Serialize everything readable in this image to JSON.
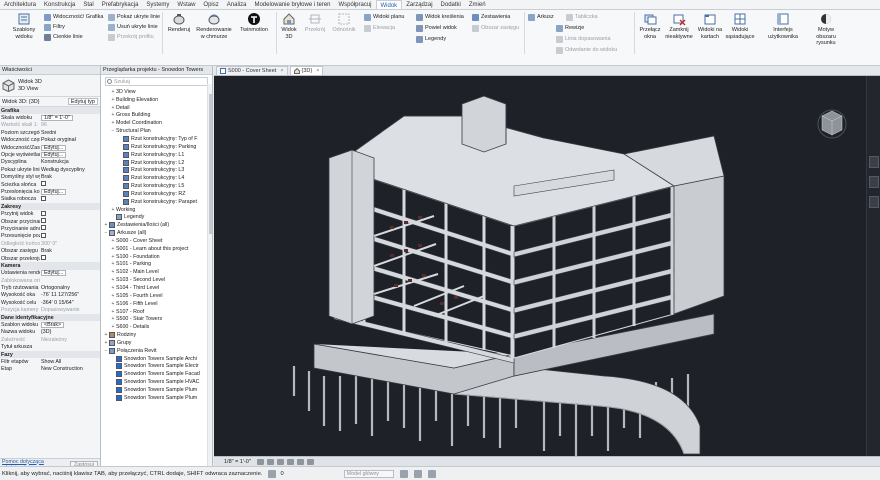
{
  "ribbon_tabs": [
    "Architektura",
    "Konstrukcja",
    "Stal",
    "Prefabrykacja",
    "Systemy",
    "Wstaw",
    "Opisz",
    "Analiza",
    "Modelowanie bryłowe i teren",
    "Współpracuj",
    "Widok",
    "Zarządzaj",
    "Dodatki",
    "Zmień"
  ],
  "active_ribbon_tab": "Widok",
  "ribbon": {
    "templates_label": "Szablony widoku",
    "visibility_graphics": "Widoczność/ Grafika",
    "filters": "Filtry",
    "thin_lines": "Cienkie linie",
    "show_hidden_lines": "Pokaż ukryte linie",
    "remove_hidden_lines": "Usuń ukryte linie",
    "cut_profile": "Przekrój profilu",
    "render": "Renderuj",
    "render_cloud": "Renderowanie w chmurze",
    "twinmotion": "Twinmotion",
    "view_3d": "Widok 3D",
    "section": "Przekrój",
    "callout": "Odnośnik",
    "plan_views": "Widoki planu",
    "elevation": "Elewacja",
    "sheet_view": "Widok kreślenia",
    "duplicate_view": "Powiel widok",
    "legends": "Legendy",
    "schedules": "Zestawienia",
    "scope_box": "Obszar zasięgu",
    "sheet": "Arkusz",
    "revisions": "Rewizje",
    "title_block": "Tabliczka",
    "matchline": "Linia dopasowania",
    "view_reference": "Odwołanie do widoku",
    "switch_windows": "Przełącz okna",
    "close_inactive": "Zamknij nieaktywne",
    "tab_views": "Widoki na kartach",
    "tile_views": "Widoki sąsiadujące",
    "user_interface": "Interfejs użytkownika",
    "macros": "Motyw obszaru rysunku"
  },
  "properties": {
    "title": "Właściwości",
    "type_name": "Widok 3D",
    "type_sub": "3D View",
    "selector": "Widok 3D: {3D}",
    "edit_type": "Edytuj typ",
    "rows": [
      {
        "k": "Grafika",
        "v": "",
        "g": true
      },
      {
        "k": "Skala widoku",
        "v": "1/8\" = 1'-0\"",
        "box": true
      },
      {
        "k": "Wartość skali 1:",
        "v": "96",
        "dim": true
      },
      {
        "k": "Poziom szczegółów",
        "v": "Średni"
      },
      {
        "k": "Widoczność części",
        "v": "Pokaż oryginał"
      },
      {
        "k": "Widoczność/Zastępowanie grafiki",
        "v": "Edytuj...",
        "box": true
      },
      {
        "k": "Opcje wyświetlania grafiki",
        "v": "Edytuj...",
        "box": true
      },
      {
        "k": "Dyscyplina",
        "v": "Konstrukcja"
      },
      {
        "k": "Pokaż ukryte linie",
        "v": "Według dyscypliny"
      },
      {
        "k": "Domyślny styl wyświetlania",
        "v": "Brak"
      },
      {
        "k": "Ścieżka słońca",
        "v": "",
        "chk": true
      },
      {
        "k": "Przesłonięcia kolorem",
        "v": "Edytuj...",
        "box": true
      },
      {
        "k": "Siatka robocza",
        "v": "",
        "chk": true
      },
      {
        "k": "Zakresy",
        "v": "",
        "g": true
      },
      {
        "k": "Przytnij widok",
        "v": "",
        "chk": true
      },
      {
        "k": "Obszar przycinania widoczny",
        "v": "",
        "chk": true
      },
      {
        "k": "Przycinanie adnotacji",
        "v": "",
        "chk": true
      },
      {
        "k": "Przesunięcie pozycjonowania",
        "v": "",
        "chk": true
      },
      {
        "k": "Odległość końcowa",
        "v": "300' 0\"",
        "dim": true
      },
      {
        "k": "Obszar zasięgu",
        "v": "Brak"
      },
      {
        "k": "Obszar przekroju",
        "v": "",
        "chk": true
      },
      {
        "k": "Kamera",
        "v": "",
        "g": true
      },
      {
        "k": "Ustawienia renderowania",
        "v": "Edytuj...",
        "box": true
      },
      {
        "k": "Zablokowana orientacja",
        "v": "",
        "dim": true
      },
      {
        "k": "Tryb rzutowania",
        "v": "Ortogonalny"
      },
      {
        "k": "Wysokość oka",
        "v": "-76' 11 127/256\""
      },
      {
        "k": "Wysokość celu",
        "v": "-364' 0 15/64\""
      },
      {
        "k": "Pozycja kamery",
        "v": "Dopasowywanie",
        "dim": true
      },
      {
        "k": "Dane identyfikacyjne",
        "v": "",
        "g": true
      },
      {
        "k": "Szablon widoku",
        "v": "<Brak>",
        "box": true
      },
      {
        "k": "Nazwa widoku",
        "v": "{3D}"
      },
      {
        "k": "Zależność",
        "v": "Niezależny",
        "dim": true
      },
      {
        "k": "Tytuł arkusza",
        "v": ""
      },
      {
        "k": "Fazy",
        "v": "",
        "g": true
      },
      {
        "k": "Filtr etapów",
        "v": "Show All"
      },
      {
        "k": "Etap",
        "v": "New Construction"
      }
    ],
    "help_link": "Pomoc dotycząca właściwości",
    "apply": "Zastosuj"
  },
  "browser": {
    "title": "Przeglądarka projektu - Snowdon Towers",
    "search_placeholder": "Szukaj",
    "nodes": [
      {
        "t": "3D View",
        "d": 1,
        "e": "+"
      },
      {
        "t": "Building Elevation",
        "d": 1,
        "e": "+"
      },
      {
        "t": "Detail",
        "d": 1,
        "e": "+"
      },
      {
        "t": "Gross Building",
        "d": 1,
        "e": "+"
      },
      {
        "t": "Model Coordination",
        "d": 1,
        "e": "+"
      },
      {
        "t": "Structural Plan",
        "d": 1,
        "e": "−"
      },
      {
        "t": "Rzut konstrukcyjny: Typ of F",
        "d": 2,
        "i": "plan"
      },
      {
        "t": "Rzut konstrukcyjny: Parking",
        "d": 2,
        "i": "plan"
      },
      {
        "t": "Rzut konstrukcyjny: L1",
        "d": 2,
        "i": "plan"
      },
      {
        "t": "Rzut konstrukcyjny: L2",
        "d": 2,
        "i": "plan"
      },
      {
        "t": "Rzut konstrukcyjny: L3",
        "d": 2,
        "i": "plan"
      },
      {
        "t": "Rzut konstrukcyjny: L4",
        "d": 2,
        "i": "plan"
      },
      {
        "t": "Rzut konstrukcyjny: L5",
        "d": 2,
        "i": "plan"
      },
      {
        "t": "Rzut konstrukcyjny: RZ",
        "d": 2,
        "i": "plan"
      },
      {
        "t": "Rzut konstrukcyjny: Parapet",
        "d": 2,
        "i": "plan"
      },
      {
        "t": "Working",
        "d": 1,
        "e": "+"
      },
      {
        "t": "Legendy",
        "d": 1,
        "i": "legend"
      },
      {
        "t": "Zestawienia/Ilości (all)",
        "d": 0,
        "e": "+",
        "i": "sched"
      },
      {
        "t": "Arkusze (all)",
        "d": 0,
        "e": "−",
        "i": "sheet"
      },
      {
        "t": "S000 - Cover Sheet",
        "d": 1,
        "e": "+"
      },
      {
        "t": "S001 - Learn about this project",
        "d": 1,
        "e": "+"
      },
      {
        "t": "S100 - Foundation",
        "d": 1,
        "e": "+"
      },
      {
        "t": "S101 - Parking",
        "d": 1,
        "e": "+"
      },
      {
        "t": "S102 - Main Level",
        "d": 1,
        "e": "+"
      },
      {
        "t": "S103 - Second Level",
        "d": 1,
        "e": "+"
      },
      {
        "t": "S104 - Third Level",
        "d": 1,
        "e": "+"
      },
      {
        "t": "S105 - Fourth Level",
        "d": 1,
        "e": "+"
      },
      {
        "t": "S106 - Fifth Level",
        "d": 1,
        "e": "+"
      },
      {
        "t": "S107 - Roof",
        "d": 1,
        "e": "+"
      },
      {
        "t": "S500 - Stair Towers",
        "d": 1,
        "e": "+"
      },
      {
        "t": "S600 - Details",
        "d": 1,
        "e": "+"
      },
      {
        "t": "Rodziny",
        "d": 0,
        "e": "+",
        "i": "fam"
      },
      {
        "t": "Grupy",
        "d": 0,
        "e": "+",
        "i": "grp"
      },
      {
        "t": "Połączenia Revit",
        "d": 0,
        "e": "−",
        "i": "link"
      },
      {
        "t": "Snowdon Towers Sample Archi",
        "d": 1,
        "i": "rlink"
      },
      {
        "t": "Snowdon Towers Sample Electr",
        "d": 1,
        "i": "rlink"
      },
      {
        "t": "Snowdon Towers Sample Facad",
        "d": 1,
        "i": "rlink"
      },
      {
        "t": "Snowdon Towers Sample HVAC",
        "d": 1,
        "i": "rlink"
      },
      {
        "t": "Snowdon Towers Sample Plum",
        "d": 1,
        "i": "rlink"
      },
      {
        "t": "Snowdon Towers Sample Plum",
        "d": 1,
        "i": "rlink"
      }
    ]
  },
  "view_tabs": [
    {
      "label": "S000 - Cover Sheet",
      "active": false
    },
    {
      "label": "{3D}",
      "active": true
    }
  ],
  "view_bar": {
    "scale": "1/8\" = 1'-0\""
  },
  "status": {
    "message": "Kliknij, aby wybrać, naciśnij klawisz TAB, aby przełączyć, CTRL dodaje, SHIFT odwraca zaznaczenie.",
    "model": "Model główny",
    "zero": "0"
  },
  "colors": {
    "canvas_bg": "#1e2128",
    "slab": "#d6d9dd",
    "edge": "#2a2d33",
    "accent": "#1f5fa8"
  }
}
